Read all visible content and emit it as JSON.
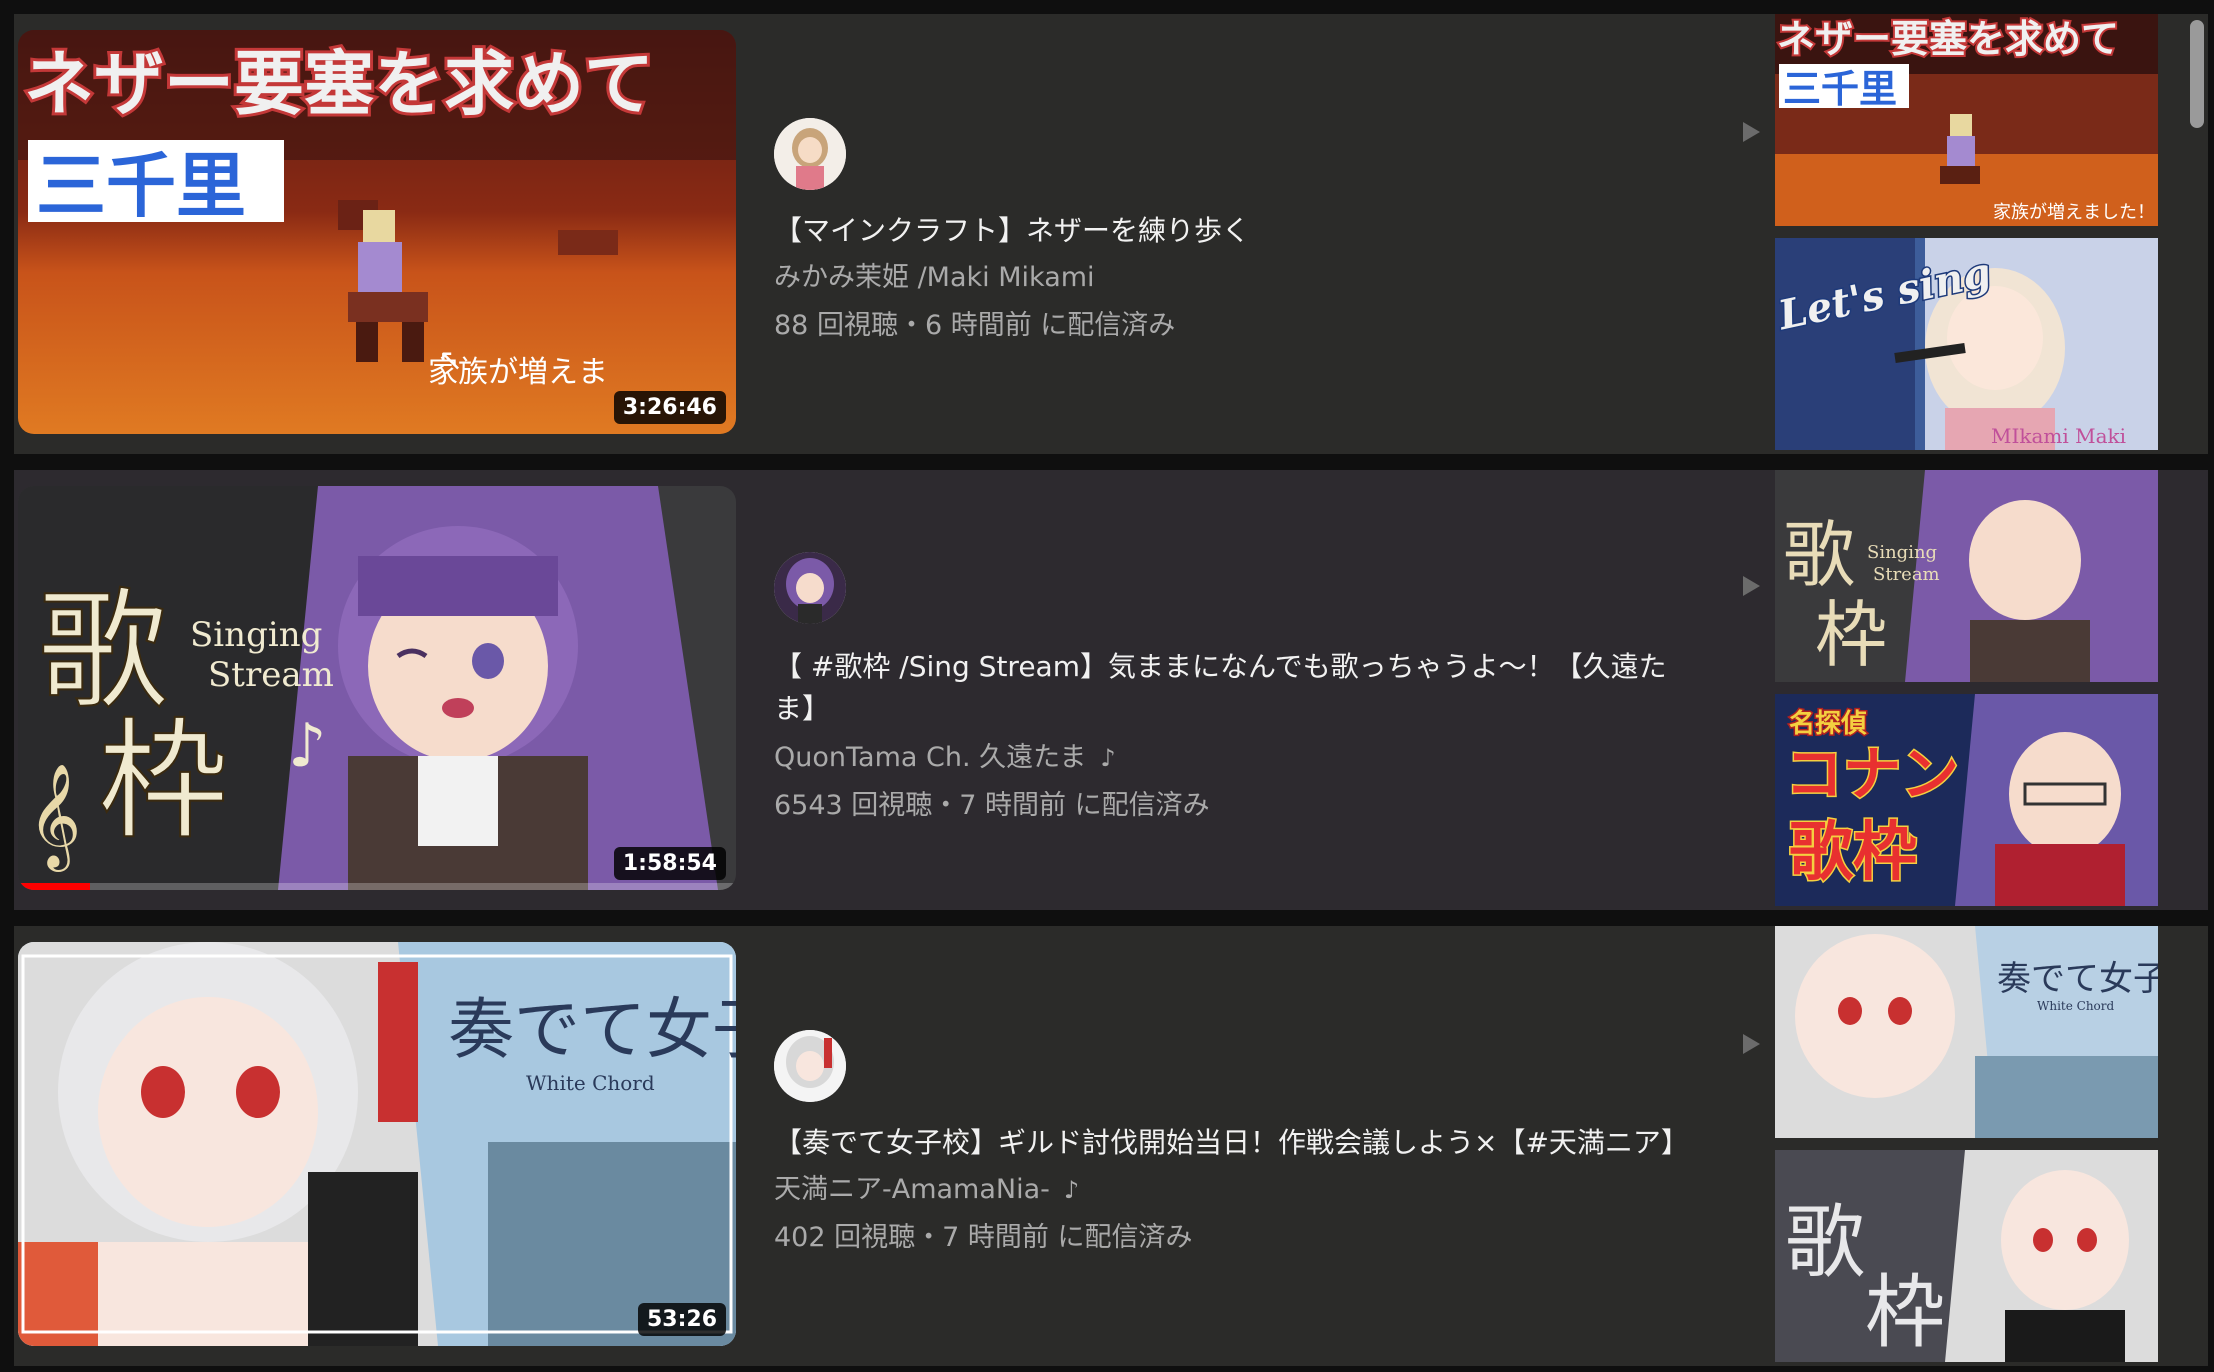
{
  "videos": [
    {
      "title": "【マインクラフト】ネザーを練り歩く",
      "channel": "みかみ茉姫 /Maki Mikami",
      "meta": "88 回視聴・6 時間前 に配信済み",
      "duration": "3:26:46",
      "thumb_text_main": "ネザー要塞を求めて",
      "thumb_text_sub": "三千里",
      "thumb_text_note": "家族が増えま",
      "has_music_badge": false
    },
    {
      "title": "【 #歌枠 /Sing Stream】気ままになんでも歌っちゃうよ〜！【久遠たま】",
      "channel": "QuonTama Ch. 久遠たま",
      "meta": "6543 回視聴・7 時間前 に配信済み",
      "duration": "1:58:54",
      "thumb_text_main": "歌枠",
      "thumb_text_sub": "Singing Stream",
      "has_music_badge": true,
      "progress": 0.1
    },
    {
      "title": "【奏でて女子校】ギルド討伐開始当日！作戦会議しよう×【#天満ニア】",
      "channel": "天満ニア-AmamaNia-",
      "meta": "402 回視聴・7 時間前 に配信済み",
      "duration": "53:26",
      "thumb_text_main": "奏でて女子校",
      "thumb_text_sub": "White Chord",
      "has_music_badge": true
    }
  ],
  "side_thumbs": [
    {
      "text_main": "ネザー要塞を求めて",
      "text_sub": "三千里",
      "text_note": "家族が増えました！"
    },
    {
      "text_main": "Let's sing",
      "text_sub": "MIkami Maki"
    },
    {
      "text_main": "歌枠",
      "text_sub": "Singing Stream"
    },
    {
      "text_main": "名探偵",
      "text_sub": "コナン",
      "text_note": "歌枠"
    },
    {
      "text_main": "奏でて女子校",
      "text_sub": "White Chord"
    },
    {
      "text_main": "歌枠"
    }
  ],
  "icons": {
    "music_note": "♪",
    "play_arrow": "play-arrow-icon"
  },
  "colors": {
    "progress": "#ff0000",
    "row_bg": "#2b2b29",
    "title": "#f1f1f1",
    "secondary": "#aaaaaa"
  }
}
